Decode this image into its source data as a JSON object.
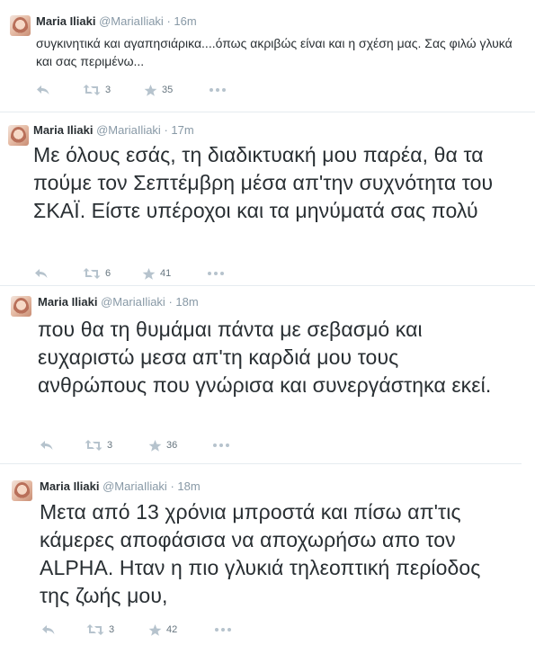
{
  "tweets": [
    {
      "name": "Maria Iliaki",
      "handle": "@MariaIliaki",
      "separator": "·",
      "time": "16m",
      "text": "συγκινητικά και αγαπησιάρικα....όπως ακριβώς είναι και η σχέση μας. Σας φιλώ γλυκά και σας περιμένω...",
      "retweets": "3",
      "favorites": "35"
    },
    {
      "name": "Maria Iliaki",
      "handle": "@MariaIliaki",
      "separator": "·",
      "time": "17m",
      "text": "Με όλους εσάς, τη διαδικτυακή μου παρέα, θα τα πούμε τον Σεπτέμβρη μέσα απ'την συχνότητα του ΣΚΑΪ. Είστε υπέροχοι και τα μηνύματά σας πολύ",
      "retweets": "6",
      "favorites": "41"
    },
    {
      "name": "Maria Iliaki",
      "handle": "@MariaIliaki",
      "separator": "·",
      "time": "18m",
      "text": "που θα τη θυμάμαι πάντα με σεβασμό και ευχαριστώ μεσα απ'τη καρδιά μου τους ανθρώπους που γνώρισα και συνεργάστηκα εκεί.",
      "retweets": "3",
      "favorites": "36"
    },
    {
      "name": "Maria Iliaki",
      "handle": "@MariaIliaki",
      "separator": "·",
      "time": "18m",
      "text": "Μετα από 13 χρόνια μπροστά και πίσω απ'τις κάμερες αποφάσισα να αποχωρήσω απο τον ALPHA. Ηταν η πιο γλυκιά τηλεοπτική περίοδος της ζωής μου,",
      "retweets": "3",
      "favorites": "42"
    }
  ]
}
